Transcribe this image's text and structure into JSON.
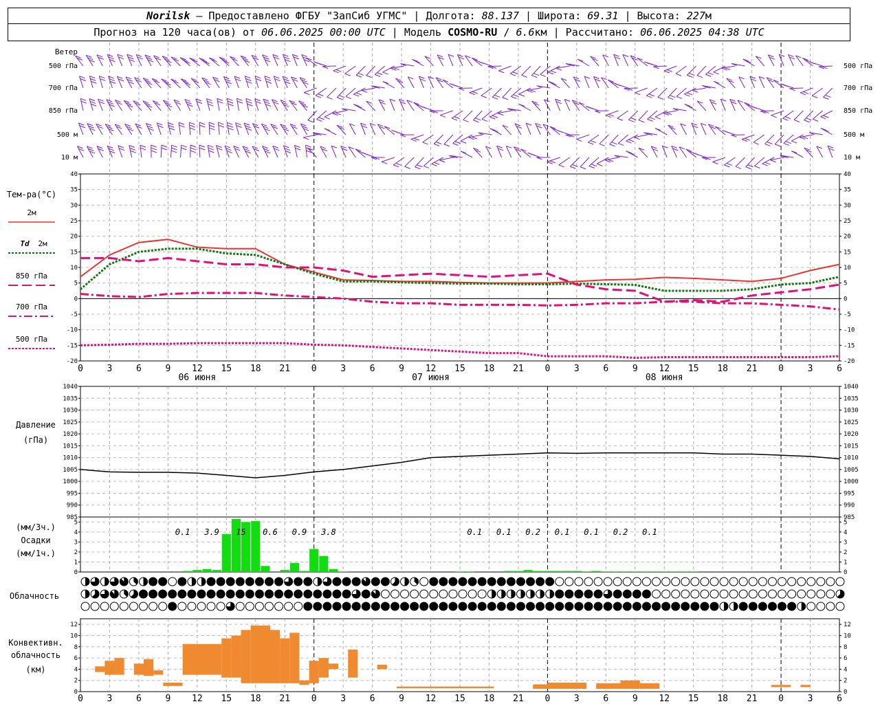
{
  "header": {
    "city": "Norilsk",
    "dash": " – ",
    "provider": "Предоставлено ФГБУ \"ЗапСиб УГМС\"",
    "sep": " | ",
    "lon_label": "Долгота: ",
    "lon": "88.137",
    "lat_label": "Широта: ",
    "lat": "69.31",
    "alt_label": "Высота: ",
    "alt": "227",
    "alt_unit": "м",
    "forecast_label": "Прогноз на 120 часа(ов) от ",
    "forecast_time": "06.06.2025 00:00 UTC",
    "model_label": "  | Модель ",
    "model": "COSMO-RU",
    "model_res_sep": " / ",
    "model_res": "6.6",
    "model_res_unit": "км",
    "computed_label": " | Рассчитано: ",
    "computed_time": "06.06.2025 04:38 UTC"
  },
  "panels": {
    "wind": {
      "title": "Ветер",
      "levels": [
        "500 гПа",
        "700 гПа",
        "850 гПа",
        "500 м",
        "10 м"
      ],
      "color": "#7B1FD0"
    },
    "temp": {
      "title": "Тем-ра(°C)",
      "yticks": [
        40,
        35,
        30,
        25,
        20,
        15,
        10,
        5,
        0,
        -5,
        -10,
        -15,
        -20
      ]
    },
    "pressure": {
      "title_1": "Давление",
      "title_2": "(гПа)",
      "yticks": [
        1040,
        1035,
        1030,
        1025,
        1020,
        1015,
        1010,
        1005,
        1000,
        995,
        990,
        985
      ]
    },
    "precip": {
      "title_1": "(мм/3ч.)",
      "title_2": "Осадки",
      "title_3": "(мм/1ч.)",
      "yticks": [
        5,
        4,
        3,
        2,
        1,
        0
      ]
    },
    "cloud": {
      "title": "Облачность"
    },
    "convective": {
      "title_1": "Конвективн.",
      "title_2": "облачность",
      "title_3": "(км)",
      "yticks": [
        12,
        10,
        8,
        6,
        4,
        2,
        0
      ]
    }
  },
  "time_axis": {
    "hour_labels": [
      "0",
      "3",
      "6",
      "9",
      "12",
      "15",
      "18",
      "21",
      "0",
      "3",
      "6",
      "9",
      "12",
      "15",
      "18",
      "21",
      "0",
      "3",
      "6",
      "9",
      "12",
      "15",
      "18",
      "21",
      "0",
      "3",
      "6"
    ],
    "day_labels": [
      "06 июня",
      "07 июня",
      "08 июня"
    ]
  },
  "legend": [
    {
      "label": "2м",
      "color": "#EE3333",
      "style": "solid"
    },
    {
      "label": "Td",
      "label2": "2м",
      "color": "#117711",
      "style": "dotted"
    },
    {
      "label": "850 гПа",
      "color": "#E0107A",
      "style": "dashed"
    },
    {
      "label": "700 гПа",
      "color": "#E0107A",
      "style": "dashdot"
    },
    {
      "label": "500 гПа",
      "color": "#E0107A",
      "style": "dotted"
    }
  ],
  "chart_data": [
    {
      "type": "line",
      "panel": "temperature",
      "ylim": [
        -20,
        40
      ],
      "x_hours": [
        0,
        3,
        6,
        9,
        12,
        15,
        18,
        21,
        24,
        27,
        30,
        33,
        36,
        39,
        42,
        45,
        48,
        51,
        54,
        57,
        60,
        63,
        66,
        69,
        72,
        75,
        78
      ],
      "series": [
        {
          "name": "2м",
          "color": "#EE3333",
          "values": [
            7,
            14,
            18,
            19,
            16.5,
            16,
            16,
            11,
            8.5,
            6,
            5.8,
            5.5,
            5.5,
            5.2,
            5,
            5,
            5,
            5.5,
            6,
            6.2,
            6.8,
            6.5,
            6,
            5.5,
            6.5,
            9,
            11
          ]
        },
        {
          "name": "Td 2м",
          "color": "#117711",
          "values": [
            3,
            11,
            15,
            16,
            16,
            14.5,
            14,
            11,
            8,
            5.5,
            5.5,
            5.2,
            5,
            4.8,
            4.8,
            4.6,
            4.6,
            4.8,
            4.6,
            4.4,
            2.5,
            2.5,
            2.5,
            3,
            4.5,
            5,
            7
          ]
        },
        {
          "name": "850 гПа",
          "color": "#E0107A",
          "values": [
            13,
            13,
            12,
            13,
            12,
            11,
            11,
            10,
            10,
            9,
            7,
            7.5,
            8,
            7.5,
            7,
            7.5,
            8,
            4.5,
            3,
            2.5,
            -1,
            -0.5,
            -1,
            1,
            2,
            3,
            4.5
          ]
        },
        {
          "name": "700 гПа",
          "color": "#E0107A",
          "values": [
            1.5,
            0.8,
            0.5,
            1.5,
            1.8,
            1.8,
            1.8,
            1,
            0.5,
            0,
            -1,
            -1.5,
            -1.5,
            -2,
            -2,
            -2,
            -2.2,
            -2,
            -1.5,
            -1.5,
            -1,
            -1,
            -1.5,
            -1.5,
            -2,
            -2.5,
            -3.5
          ]
        },
        {
          "name": "500 гПа",
          "color": "#E0107A",
          "values": [
            -15,
            -14.8,
            -14.5,
            -14.5,
            -14.3,
            -14.3,
            -14.3,
            -14.3,
            -14.8,
            -15,
            -15.5,
            -16,
            -16.5,
            -17,
            -17.5,
            -17.5,
            -18.5,
            -18.5,
            -18.5,
            -19,
            -18.8,
            -18.8,
            -18.8,
            -18.8,
            -18.8,
            -18.8,
            -18.5
          ]
        }
      ]
    },
    {
      "type": "line",
      "panel": "pressure",
      "ylim": [
        985,
        1040
      ],
      "x_hours": [
        0,
        3,
        6,
        9,
        12,
        15,
        18,
        21,
        24,
        27,
        30,
        33,
        36,
        39,
        42,
        45,
        48,
        51,
        54,
        57,
        60,
        63,
        66,
        69,
        72,
        75,
        78
      ],
      "series": [
        {
          "name": "Давление",
          "color": "#000000",
          "values": [
            1005,
            1004,
            1003.8,
            1003.8,
            1003.5,
            1002.5,
            1001.5,
            1002.5,
            1004,
            1005,
            1006.5,
            1008,
            1010,
            1010.5,
            1011,
            1011.5,
            1012,
            1011.8,
            1012,
            1012,
            1012,
            1012,
            1011.5,
            1011.5,
            1011,
            1010.5,
            1009.5
          ]
        }
      ]
    },
    {
      "type": "bar",
      "panel": "precipitation",
      "ylim": [
        0,
        5.5
      ],
      "x_hours": [
        9,
        10,
        11,
        12,
        13,
        14,
        15,
        16,
        17,
        18,
        19,
        20,
        21,
        22,
        23,
        24,
        25,
        26,
        27,
        28,
        29,
        30,
        31,
        32,
        33,
        34,
        35,
        36,
        37,
        38,
        39,
        40,
        41,
        42,
        43,
        44,
        45,
        46,
        47,
        48,
        49,
        50,
        51,
        52,
        53,
        54,
        55,
        56,
        57,
        58,
        59,
        60,
        61,
        62,
        63,
        64,
        65,
        66,
        67,
        68
      ],
      "values": [
        0,
        0,
        0.1,
        0.2,
        0.3,
        0.2,
        3.8,
        5.3,
        5.0,
        5.1,
        0.6,
        0,
        0.2,
        0.9,
        0.1,
        2.3,
        1.6,
        0.3,
        0.05,
        0,
        0,
        0,
        0,
        0,
        0,
        0,
        0,
        0,
        0,
        0,
        0.05,
        0.05,
        0,
        0,
        0,
        0.1,
        0.1,
        0.2,
        0.1,
        0.1,
        0.1,
        0.1,
        0.1,
        0.05,
        0.1,
        0.05,
        0.05,
        0.05,
        0.05,
        0.05,
        0.05,
        0.05,
        0.05,
        0.05,
        0.05,
        0,
        0,
        0,
        0,
        0
      ],
      "labels_3h": [
        {
          "hour": 10.5,
          "text": "0.1"
        },
        {
          "hour": 13.5,
          "text": "3.9"
        },
        {
          "hour": 16.5,
          "text": "15"
        },
        {
          "hour": 19.5,
          "text": "0.6"
        },
        {
          "hour": 22.5,
          "text": "0.9"
        },
        {
          "hour": 25.5,
          "text": "3.8"
        },
        {
          "hour": 40.5,
          "text": "0.1"
        },
        {
          "hour": 43.5,
          "text": "0.1"
        },
        {
          "hour": 46.5,
          "text": "0.2"
        },
        {
          "hour": 49.5,
          "text": "0.1"
        },
        {
          "hour": 52.5,
          "text": "0.1"
        },
        {
          "hour": 55.5,
          "text": "0.2"
        },
        {
          "hour": 58.5,
          "text": "0.1"
        }
      ],
      "color": "#11DD11"
    },
    {
      "type": "bar",
      "panel": "convective_cloud",
      "ylim": [
        0,
        13
      ],
      "segments": [
        {
          "start": 1.5,
          "end": 2.5,
          "base": 3.5,
          "top": 4.5
        },
        {
          "start": 2.5,
          "end": 3.5,
          "base": 3,
          "top": 5.5
        },
        {
          "start": 3.5,
          "end": 4.5,
          "base": 3,
          "top": 6
        },
        {
          "start": 5.5,
          "end": 6.5,
          "base": 3,
          "top": 5
        },
        {
          "start": 6.5,
          "end": 7.5,
          "base": 2.8,
          "top": 5.8
        },
        {
          "start": 7.5,
          "end": 8.5,
          "base": 3,
          "top": 3.8
        },
        {
          "start": 8.5,
          "end": 10.5,
          "base": 1,
          "top": 1.6
        },
        {
          "start": 10.5,
          "end": 14.5,
          "base": 3,
          "top": 8.5
        },
        {
          "start": 14.5,
          "end": 15.5,
          "base": 2.5,
          "top": 9.5
        },
        {
          "start": 15.5,
          "end": 16.5,
          "base": 2.5,
          "top": 10
        },
        {
          "start": 16.5,
          "end": 17.5,
          "base": 1.5,
          "top": 11
        },
        {
          "start": 17.5,
          "end": 19.5,
          "base": 1.5,
          "top": 11.8
        },
        {
          "start": 19.5,
          "end": 20.5,
          "base": 1.5,
          "top": 11
        },
        {
          "start": 20.5,
          "end": 21.5,
          "base": 1.5,
          "top": 9.5
        },
        {
          "start": 21.5,
          "end": 22.5,
          "base": 1.5,
          "top": 10.5
        },
        {
          "start": 22.5,
          "end": 23.5,
          "base": 1.2,
          "top": 2
        },
        {
          "start": 23.5,
          "end": 24.5,
          "base": 1.5,
          "top": 5.5
        },
        {
          "start": 24.5,
          "end": 25.5,
          "base": 2.5,
          "top": 6
        },
        {
          "start": 25.5,
          "end": 26.5,
          "base": 4,
          "top": 5
        },
        {
          "start": 27.5,
          "end": 28.5,
          "base": 2.5,
          "top": 7.5
        },
        {
          "start": 30.5,
          "end": 31.5,
          "base": 4,
          "top": 4.8
        },
        {
          "start": 32.5,
          "end": 42.5,
          "base": 0.6,
          "top": 0.9
        },
        {
          "start": 46.5,
          "end": 48,
          "base": 0.5,
          "top": 1.3
        },
        {
          "start": 48,
          "end": 52,
          "base": 0.5,
          "top": 1.6
        },
        {
          "start": 53,
          "end": 55.5,
          "base": 0.5,
          "top": 1.5
        },
        {
          "start": 55.5,
          "end": 57.5,
          "base": 0.5,
          "top": 2
        },
        {
          "start": 57.5,
          "end": 59.5,
          "base": 0.5,
          "top": 1.5
        },
        {
          "start": 71,
          "end": 73,
          "base": 0.8,
          "top": 1.2
        },
        {
          "start": 74,
          "end": 75,
          "base": 0.8,
          "top": 1.2
        }
      ],
      "color": "#F08A30"
    },
    {
      "type": "table",
      "panel": "cloud_cover",
      "rows": [
        "upper",
        "middle",
        "lower"
      ],
      "cells": [
        [
          "4",
          "6",
          "4",
          "6",
          "7",
          "3",
          "4",
          "8",
          "8",
          "0",
          "8",
          "4",
          "4",
          "8",
          "8",
          "8",
          "8",
          "8",
          "8",
          "8",
          "8",
          "6",
          "8",
          "8",
          "4",
          "6",
          "8",
          "8",
          "8",
          "7",
          "8",
          "8",
          "5",
          "4",
          "3",
          "0",
          "8",
          "8",
          "8",
          "8",
          "8",
          "8",
          "8",
          "8",
          "8",
          "8",
          "8",
          "8",
          "8",
          "0",
          "0",
          "0",
          "0",
          "0",
          "0",
          "0",
          "0",
          "0",
          "0",
          "0",
          "0",
          "0",
          "0",
          "0",
          "0",
          "0",
          "0",
          "0",
          "0",
          "0",
          "0",
          "0",
          "0",
          "0",
          "0",
          "0",
          "0",
          "0",
          "0"
        ],
        [
          "4",
          "5",
          "6",
          "7",
          "3",
          "5",
          "8",
          "8",
          "8",
          "8",
          "8",
          "8",
          "8",
          "8",
          "8",
          "8",
          "8",
          "8",
          "8",
          "8",
          "8",
          "8",
          "8",
          "8",
          "8",
          "8",
          "8",
          "8",
          "6",
          "8",
          "7",
          "0",
          "0",
          "0",
          "0",
          "0",
          "0",
          "0",
          "0",
          "0",
          "0",
          "0",
          "4",
          "4",
          "4",
          "4",
          "4",
          "4",
          "4",
          "8",
          "8",
          "8",
          "8",
          "8",
          "6",
          "8",
          "8",
          "8",
          "8",
          "0",
          "0",
          "0",
          "0",
          "0",
          "0",
          "0",
          "0",
          "0",
          "0",
          "0",
          "0",
          "0",
          "0",
          "0",
          "0",
          "0",
          "0",
          "0",
          "5"
        ],
        [
          "0",
          "0",
          "0",
          "0",
          "0",
          "0",
          "0",
          "0",
          "0",
          "8",
          "0",
          "0",
          "0",
          "0",
          "0",
          "6",
          "0",
          "0",
          "0",
          "0",
          "0",
          "0",
          "0",
          "8",
          "8",
          "8",
          "8",
          "8",
          "8",
          "8",
          "8",
          "8",
          "8",
          "8",
          "8",
          "8",
          "8",
          "8",
          "8",
          "8",
          "8",
          "8",
          "8",
          "8",
          "8",
          "8",
          "8",
          "8",
          "8",
          "8",
          "8",
          "8",
          "8",
          "8",
          "8",
          "8",
          "8",
          "8",
          "8",
          "8",
          "8",
          "8",
          "8",
          "8",
          "8",
          "8",
          "4",
          "4",
          "8",
          "8",
          "8",
          "8",
          "8",
          "8",
          "4",
          "0",
          "0",
          "0",
          "0"
        ]
      ]
    }
  ]
}
